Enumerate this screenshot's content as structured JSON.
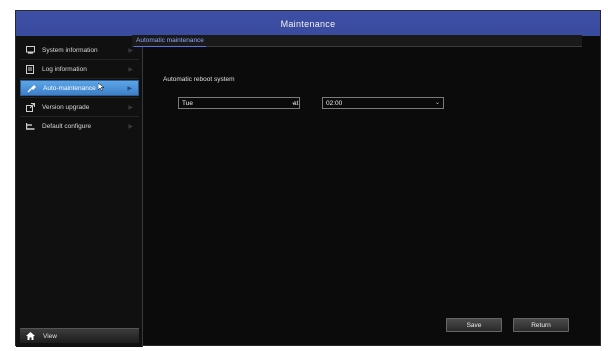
{
  "window": {
    "title": "Maintenance"
  },
  "sidebar": {
    "items": [
      {
        "label": "System information",
        "icon": "monitor-icon"
      },
      {
        "label": "Log information",
        "icon": "document-icon"
      },
      {
        "label": "Auto-maintenance",
        "icon": "wrench-icon",
        "active": true
      },
      {
        "label": "Version upgrade",
        "icon": "upgrade-icon"
      },
      {
        "label": "Default configure",
        "icon": "reset-icon"
      }
    ],
    "view_label": "View",
    "accent_color": "#4a90d9"
  },
  "tabs": [
    {
      "label": "Automatic maintenance",
      "active": true
    }
  ],
  "form": {
    "reboot_label": "Automatic reboot system",
    "day_value": "Tue",
    "at_label": "at",
    "time_value": "02:00"
  },
  "buttons": {
    "save_label": "Save",
    "return_label": "Return"
  }
}
